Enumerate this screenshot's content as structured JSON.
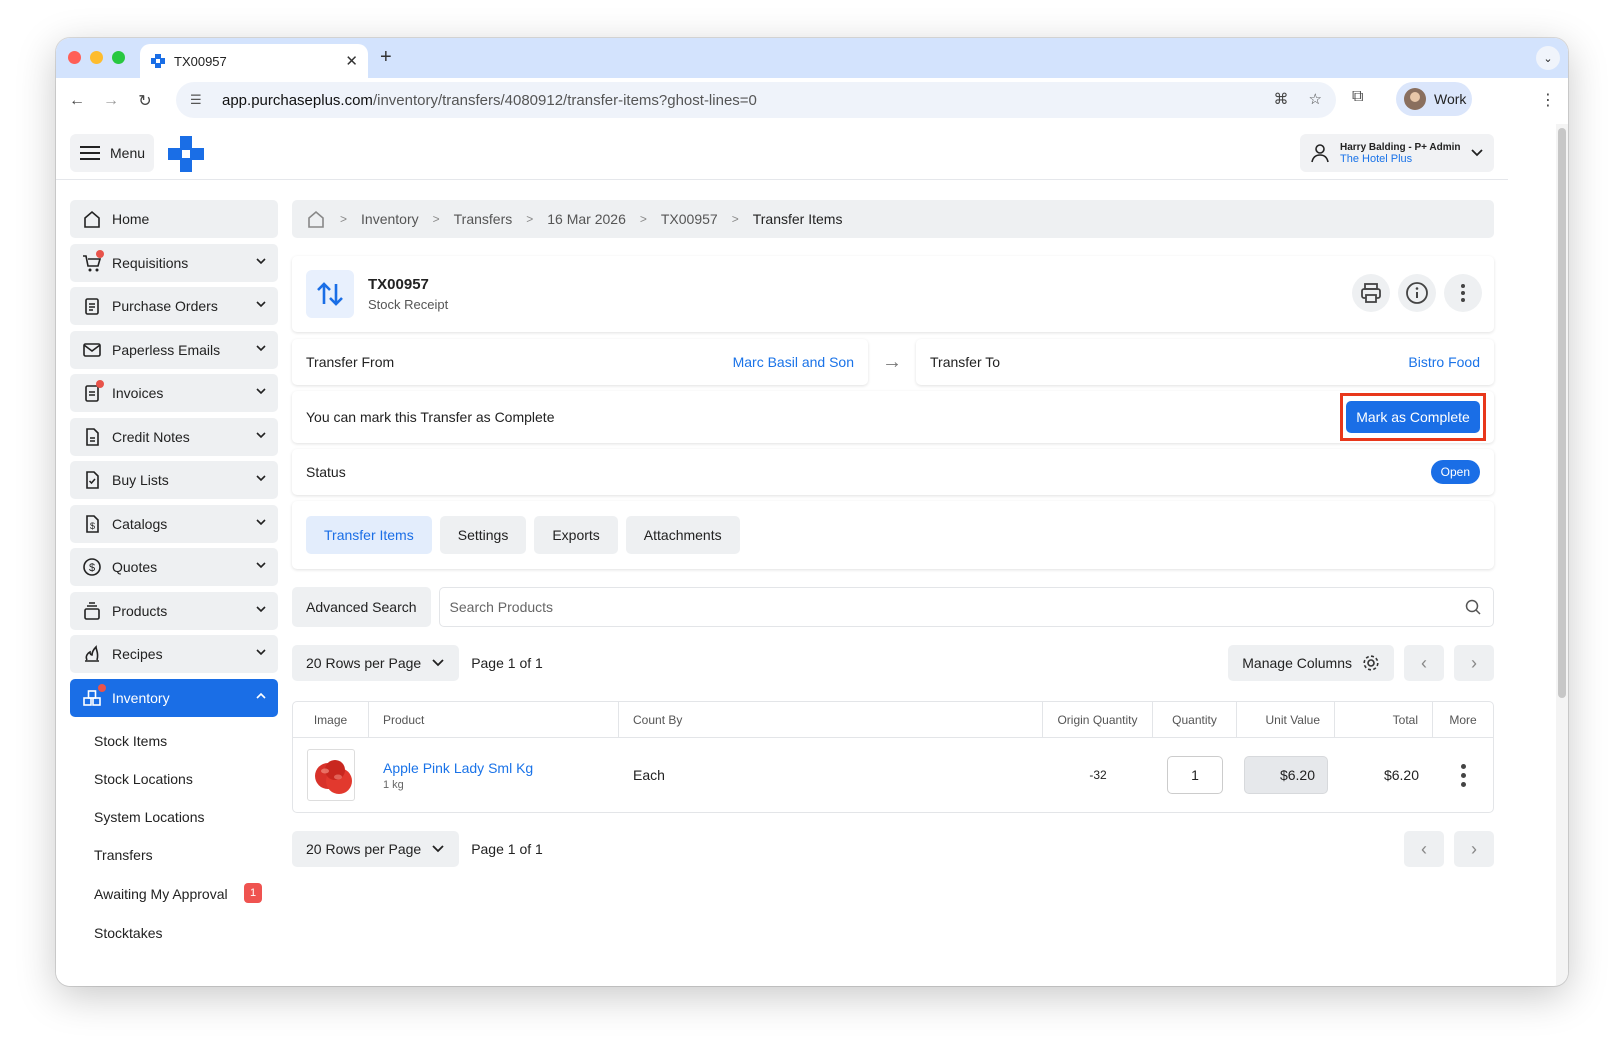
{
  "browser": {
    "tab_title": "TX00957",
    "url_host": "app.purchaseplus.com",
    "url_path": "/inventory/transfers/4080912/transfer-items?ghost-lines=0",
    "profile_label": "Work"
  },
  "topbar": {
    "menu_label": "Menu",
    "user_name": "Harry Balding - P+ Admin",
    "user_org": "The Hotel Plus"
  },
  "sidebar": {
    "items": [
      {
        "label": "Home",
        "icon": "home-icon"
      },
      {
        "label": "Requisitions",
        "icon": "cart-icon",
        "has_dot": true
      },
      {
        "label": "Purchase Orders",
        "icon": "clipboard-icon"
      },
      {
        "label": "Paperless Emails",
        "icon": "mail-icon"
      },
      {
        "label": "Invoices",
        "icon": "invoice-icon",
        "has_dot": true
      },
      {
        "label": "Credit Notes",
        "icon": "document-icon"
      },
      {
        "label": "Buy Lists",
        "icon": "checklist-icon"
      },
      {
        "label": "Catalogs",
        "icon": "dollar-doc-icon"
      },
      {
        "label": "Quotes",
        "icon": "dollar-circle-icon"
      },
      {
        "label": "Products",
        "icon": "stack-icon"
      },
      {
        "label": "Recipes",
        "icon": "flame-icon"
      },
      {
        "label": "Inventory",
        "icon": "boxes-icon",
        "active": true
      }
    ],
    "inventory_sub": [
      {
        "label": "Stock Items"
      },
      {
        "label": "Stock Locations"
      },
      {
        "label": "System Locations"
      },
      {
        "label": "Transfers"
      },
      {
        "label": "Awaiting My Approval",
        "badge": "1"
      },
      {
        "label": "Stocktakes"
      }
    ]
  },
  "breadcrumb": [
    "Inventory",
    "Transfers",
    "16 Mar 2026",
    "TX00957",
    "Transfer Items"
  ],
  "transfer": {
    "code": "TX00957",
    "type": "Stock Receipt",
    "from_label": "Transfer From",
    "from_value": "Marc Basil and Son",
    "to_label": "Transfer To",
    "to_value": "Bistro Food",
    "complete_msg": "You can mark this Transfer as Complete",
    "complete_btn": "Mark as Complete",
    "status_label": "Status",
    "status_value": "Open"
  },
  "tabs": [
    "Transfer Items",
    "Settings",
    "Exports",
    "Attachments"
  ],
  "search": {
    "advanced_label": "Advanced Search",
    "placeholder": "Search Products"
  },
  "pagination": {
    "rows_label": "20 Rows per Page",
    "page_info": "Page 1 of 1",
    "manage_columns": "Manage Columns"
  },
  "table": {
    "headers": [
      "Image",
      "Product",
      "Count By",
      "Origin Quantity",
      "Quantity",
      "Unit Value",
      "Total",
      "More"
    ],
    "rows": [
      {
        "product": "Apple Pink Lady Sml Kg",
        "size": "1 kg",
        "count_by": "Each",
        "origin_quantity": "-32",
        "quantity": "1",
        "unit_value": "$6.20",
        "total": "$6.20"
      }
    ]
  },
  "colors": {
    "primary": "#1a6ee6",
    "highlight": "#e8371b",
    "link": "#1a73e8"
  }
}
